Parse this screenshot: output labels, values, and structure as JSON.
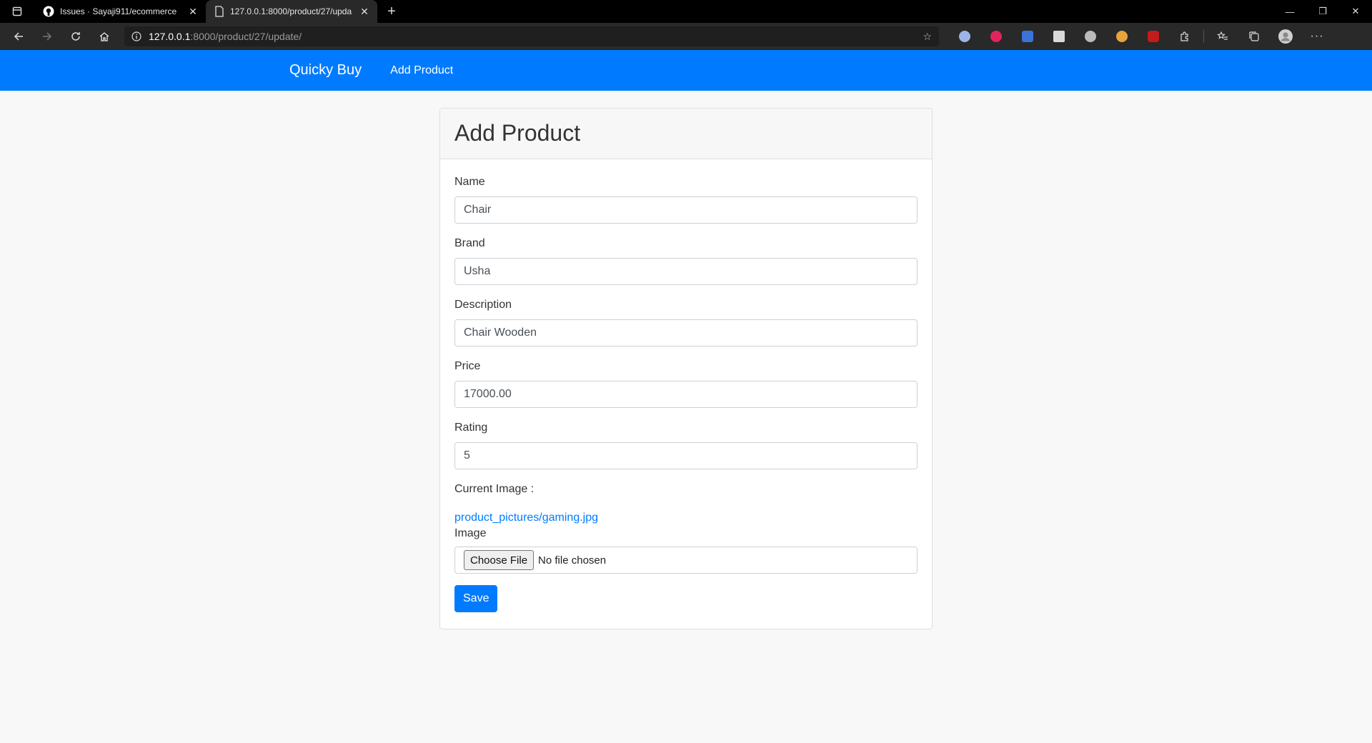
{
  "browser": {
    "tabs": [
      {
        "title": "Issues · Sayaji911/ecommerce",
        "active": false
      },
      {
        "title": "127.0.0.1:8000/product/27/upda",
        "active": true
      }
    ],
    "url_host": "127.0.0.1",
    "url_path": ":8000/product/27/update/",
    "extension_colors": [
      "#9cb5e8",
      "#e0245e",
      "#3b73d9",
      "#d9d9d9",
      "#bbbbbb",
      "#e8a33b",
      "#c51a1a"
    ]
  },
  "navbar": {
    "brand": "Quicky Buy",
    "link": "Add Product",
    "background": "#007bff"
  },
  "card": {
    "title": "Add Product",
    "fields": [
      {
        "label": "Name",
        "value": "Chair"
      },
      {
        "label": "Brand",
        "value": "Usha"
      },
      {
        "label": "Description",
        "value": "Chair Wooden"
      },
      {
        "label": "Price",
        "value": "17000.00"
      },
      {
        "label": "Rating",
        "value": "5"
      }
    ],
    "current_image_label": "Current Image :",
    "current_image_link": "product_pictures/gaming.jpg",
    "image_label": "Image",
    "choose_file": "Choose File",
    "no_file": "No file chosen",
    "save": "Save"
  }
}
